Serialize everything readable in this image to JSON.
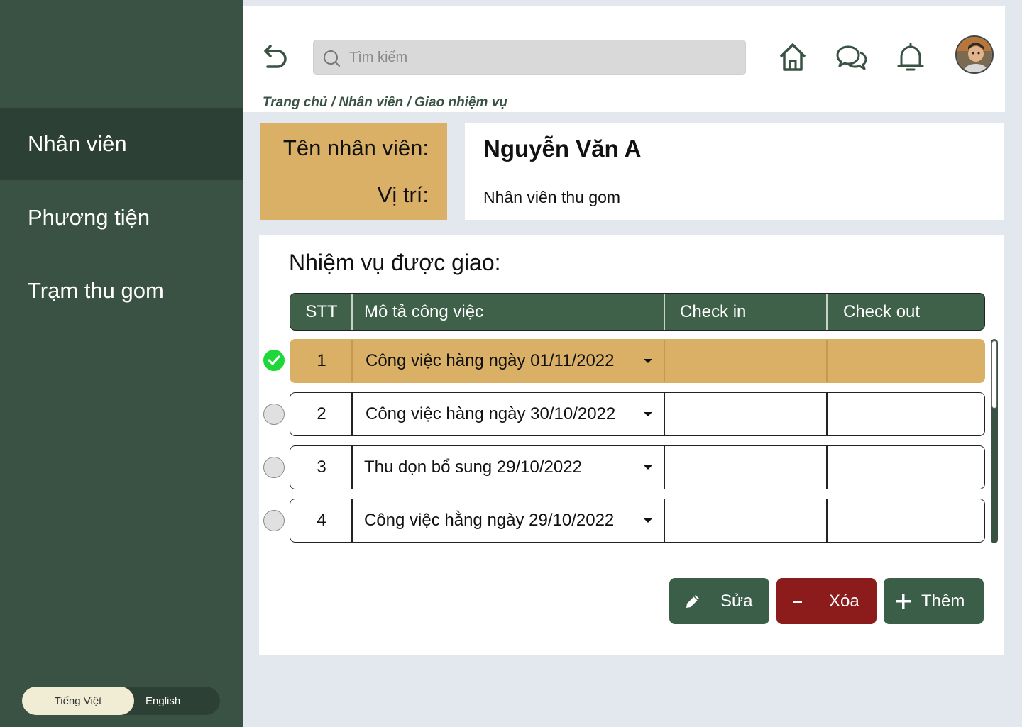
{
  "sidebar": {
    "items": [
      {
        "label": "Nhân viên",
        "active": true
      },
      {
        "label": "Phương tiện",
        "active": false
      },
      {
        "label": "Trạm thu gom",
        "active": false
      }
    ],
    "languages": {
      "vi": "Tiếng Việt",
      "en": "English",
      "selected": "vi"
    }
  },
  "header": {
    "search_placeholder": "Tìm kiếm",
    "breadcrumb": "Trang chủ / Nhân viên / Giao nhiệm vụ",
    "icons": [
      "back-arrow-icon",
      "home-icon",
      "chat-icon",
      "bell-icon"
    ]
  },
  "employee": {
    "name_label": "Tên nhân viên:",
    "position_label": "Vị trí:",
    "name": "Nguyễn Văn A",
    "position": "Nhân viên thu gom"
  },
  "tasks": {
    "title": "Nhiệm vụ được giao:",
    "columns": [
      "STT",
      "Mô tả công việc",
      "Check in",
      "Check out"
    ],
    "rows": [
      {
        "stt": "1",
        "description": "Công việc hàng ngày 01/11/2022",
        "check_in": "",
        "check_out": "",
        "selected": true
      },
      {
        "stt": "2",
        "description": "Công việc hàng ngày 30/10/2022",
        "check_in": "",
        "check_out": "",
        "selected": false
      },
      {
        "stt": "3",
        "description": "Thu dọn bổ sung 29/10/2022",
        "check_in": "",
        "check_out": "",
        "selected": false
      },
      {
        "stt": "4",
        "description": "Công việc hằng ngày 29/10/2022",
        "check_in": "",
        "check_out": "",
        "selected": false
      }
    ]
  },
  "actions": {
    "edit": "Sửa",
    "delete": "Xóa",
    "add": "Thêm"
  },
  "colors": {
    "sidebar": "#3a5244",
    "sidebar_active": "#2d4035",
    "accent": "#d9b065",
    "header_green": "#3f6049",
    "delete_red": "#8c1c1c",
    "check_green": "#1ed83a"
  }
}
